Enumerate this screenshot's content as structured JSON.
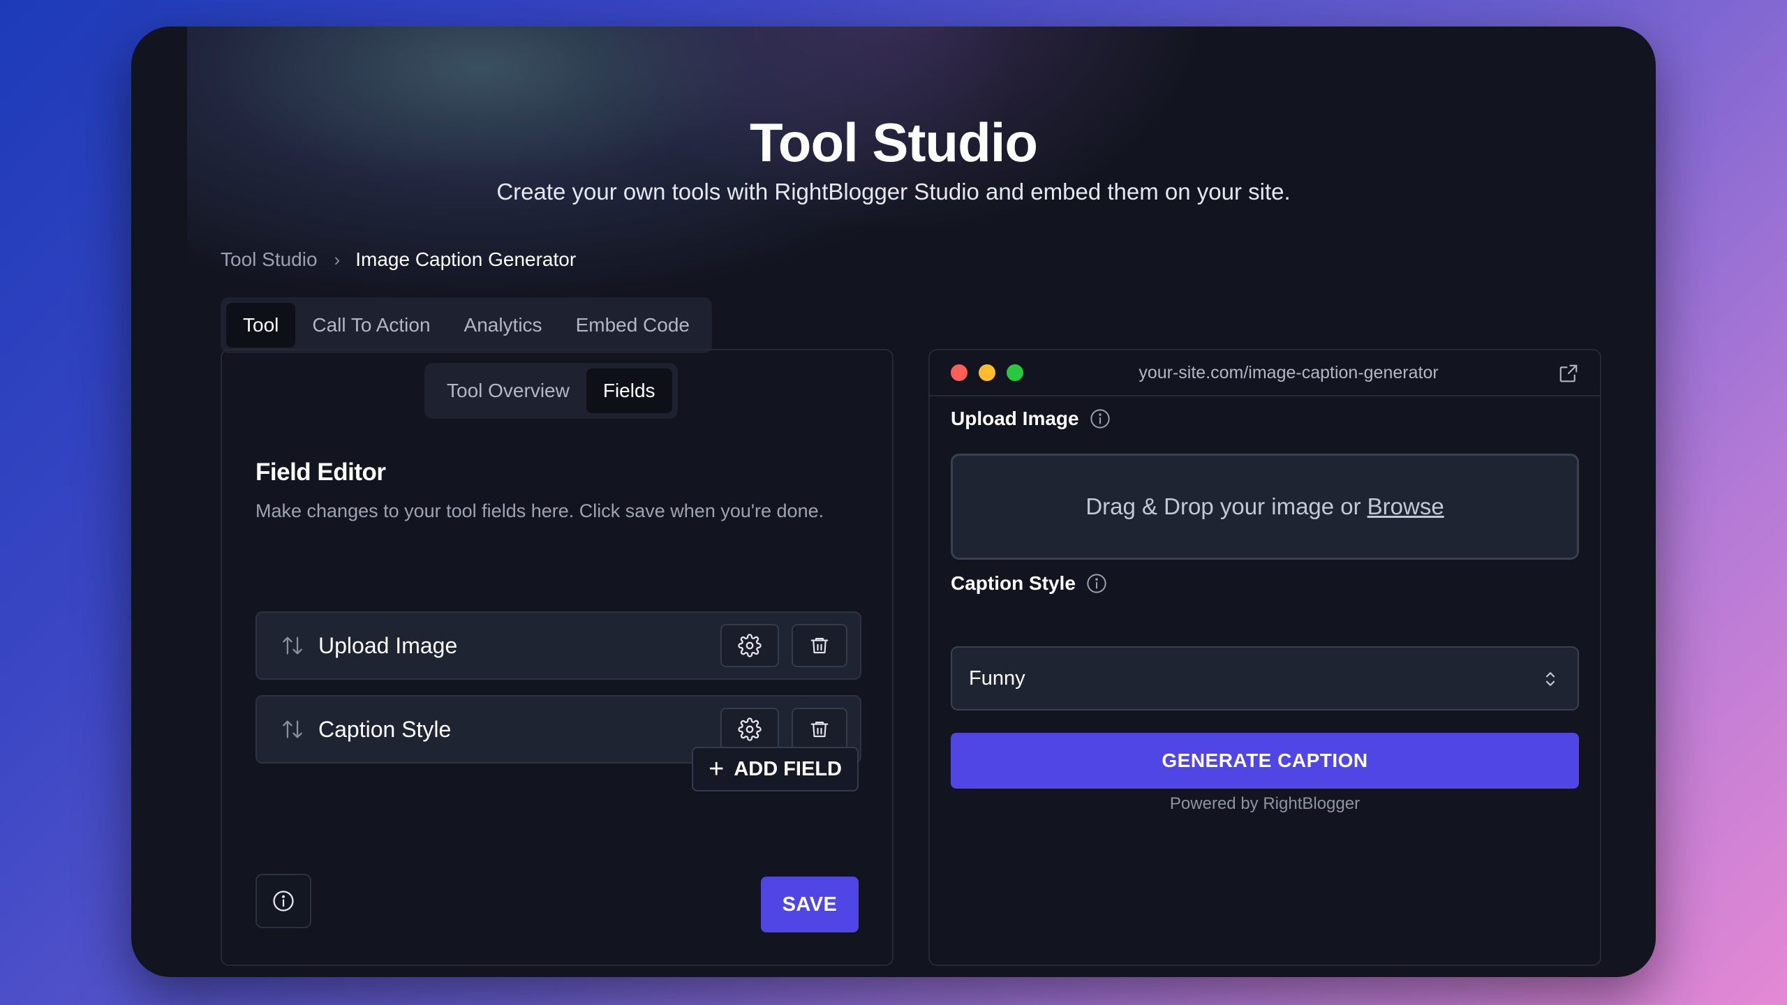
{
  "header": {
    "title": "Tool Studio",
    "subtitle": "Create your own tools with RightBlogger Studio and embed them on your site."
  },
  "breadcrumb": {
    "home": "Tool Studio",
    "separator": "›",
    "current": "Image Caption Generator"
  },
  "tabs": [
    {
      "label": "Tool",
      "active": true
    },
    {
      "label": "Call To Action",
      "active": false
    },
    {
      "label": "Analytics",
      "active": false
    },
    {
      "label": "Embed Code",
      "active": false
    }
  ],
  "editor": {
    "subtabs": [
      {
        "label": "Tool Overview",
        "active": false
      },
      {
        "label": "Fields",
        "active": true
      }
    ],
    "title": "Field Editor",
    "description": "Make changes to your tool fields here. Click save when you're done.",
    "fields": [
      {
        "label": "Upload Image"
      },
      {
        "label": "Caption Style"
      }
    ],
    "add_field_label": "ADD FIELD",
    "save_label": "SAVE"
  },
  "preview": {
    "url": "your-site.com/image-caption-generator",
    "upload_label": "Upload Image",
    "dropzone_text": "Drag & Drop your image or",
    "browse_label": "Browse",
    "caption_label": "Caption Style",
    "caption_value": "Funny",
    "generate_label": "GENERATE CAPTION",
    "powered_by": "Powered by RightBlogger"
  },
  "colors": {
    "accent": "#5046e5",
    "window_bg": "#12151f",
    "traffic_red": "#ff5f57",
    "traffic_yellow": "#febc2e",
    "traffic_green": "#28c840"
  }
}
